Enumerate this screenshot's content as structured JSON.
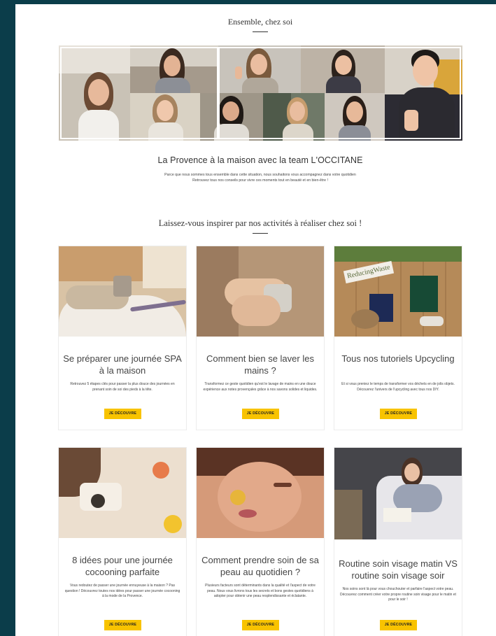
{
  "section1": {
    "title": "Ensemble, chez soi",
    "subtitle": "La Provence à la maison avec la team L'OCCITANE",
    "description_line1": "Parce que nous sommes tous ensemble dans cette situation, nous souhaitons vous accompagnez dans votre quotidien",
    "description_line2": "Retrouvez tous nos conseils pour vivre ces moments tout en beauté et en bien-être !"
  },
  "section2": {
    "title": "Laissez-vous inspirer par nos activités à réaliser chez soi !"
  },
  "cards": [
    {
      "title": "Se préparer une journée SPA à la maison",
      "text": "Retrouvez 5 étapes clés pour passer la plus douce des journées en prenant soin de soi des pieds à la tête.",
      "button": "JE DÉCOUVRE"
    },
    {
      "title": "Comment bien se laver les mains ?",
      "text": "Transformez ce geste quotidien qu'est le lavage de mains en une douce expérience aux notes provençales grâce à nos savons solides et liquides.",
      "button": "JE DÉCOUVRE"
    },
    {
      "title": "Tous nos tutoriels Upcycling",
      "text": "Et si vous preniez le temps de transformer vos déchets en de jolis objets. Découvrez l'univers de l'upcycling avec tous nos DIY.",
      "button": "JE DÉCOUVRE"
    },
    {
      "title": "8 idées pour une journée cocooning parfaite",
      "text": "Vous redoutez de passer une journée ennuyeuse à la maison ? Pas question ! Découvrez toutes nos idées pour passer une journée cocooning à la mode de la Provence.",
      "button": "JE DÉCOUVRE"
    },
    {
      "title": "Comment prendre soin de sa peau au quotidien ?",
      "text": "Plusieurs facteurs sont déterminants dans la qualité et l'aspect de votre peau. Nous vous livrons tous les secrets et bons gestes quotidiens à adopter pour obtenir une peau resplendissante et éclatante.",
      "button": "JE DÉCOUVRE"
    },
    {
      "title": "Routine soin visage matin VS routine soin visage soir",
      "text": "Nos soins sont là pour vous chouchouter et parfaire l'aspect votre peau. Découvrez comment créer votre propre routine soin visage pour le matin et pour le soir !",
      "button": "JE DÉCOUVRE"
    }
  ],
  "images": {
    "upcycling_sign": "ReducingWaste"
  },
  "colors": {
    "background": "#0b3d4a",
    "button": "#f8c300",
    "text": "#333333"
  }
}
